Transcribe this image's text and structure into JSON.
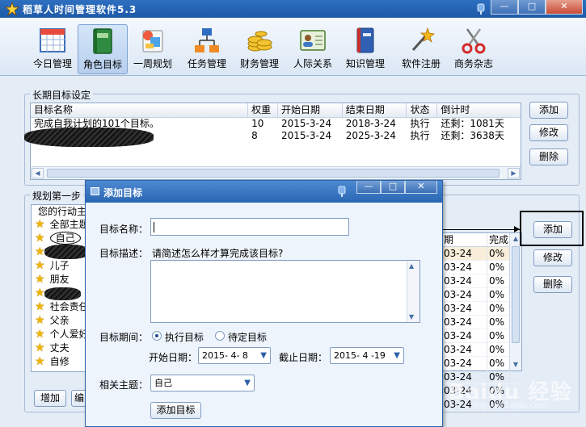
{
  "window": {
    "title": "稻草人时间管理软件5.3",
    "buttons": {
      "minimize": "—",
      "maximize": "□",
      "close": "✕"
    }
  },
  "toolbar": {
    "items": [
      {
        "label": "今日管理",
        "icon": "calendar-icon"
      },
      {
        "label": "角色目标",
        "icon": "book-icon",
        "active": true
      },
      {
        "label": "一周规划",
        "icon": "weekly-plan-icon"
      },
      {
        "label": "任务管理",
        "icon": "org-chart-icon"
      },
      {
        "label": "财务管理",
        "icon": "coins-icon"
      },
      {
        "label": "人际关系",
        "icon": "contact-card-icon"
      },
      {
        "label": "知识管理",
        "icon": "notebook-icon"
      },
      {
        "label": "软件注册",
        "icon": "magic-wand-icon"
      },
      {
        "label": "商务杂志",
        "icon": "scissors-icon"
      }
    ]
  },
  "long_term": {
    "title": "长期目标设定",
    "columns": [
      "目标名称",
      "权重",
      "开始日期",
      "结束日期",
      "状态",
      "倒计时"
    ],
    "rows": [
      {
        "name": "完成自我计划的101个目标。",
        "weight": "10",
        "start": "2015-3-24",
        "end": "2018-3-24",
        "status": "执行",
        "countdown": "还剩：1081天"
      },
      {
        "name": "",
        "weight": "8",
        "start": "2015-3-24",
        "end": "2025-3-24",
        "status": "执行",
        "countdown": "还剩：3638天"
      }
    ],
    "buttons": {
      "add": "添加",
      "edit": "修改",
      "delete": "删除"
    }
  },
  "plan": {
    "title": "规划第一步",
    "tree_header": "您的行动主",
    "nodes": [
      "全部主题",
      "自己",
      "",
      "儿子",
      "朋友",
      "",
      "社会责任",
      "父亲",
      "个人爱好",
      "丈夫",
      "自修"
    ],
    "bottom_buttons": {
      "add": "增加",
      "more": "编"
    },
    "buttons": {
      "add": "添加",
      "edit": "修改",
      "delete": "删除"
    },
    "right_table": {
      "columns": [
        "期",
        "完成"
      ],
      "rows": [
        [
          "03-24",
          "0%"
        ],
        [
          "03-24",
          "0%"
        ],
        [
          "03-24",
          "0%"
        ],
        [
          "03-24",
          "0%"
        ],
        [
          "03-24",
          "0%"
        ],
        [
          "03-24",
          "0%"
        ],
        [
          "03-24",
          "0%"
        ],
        [
          "03-24",
          "0%"
        ],
        [
          "03-24",
          "0%"
        ],
        [
          "03-24",
          "0%"
        ],
        [
          "03-24",
          "0%"
        ],
        [
          "03-24",
          "0%"
        ]
      ]
    }
  },
  "dialog": {
    "title": "添加目标",
    "name_label": "目标名称：",
    "name_value": "",
    "desc_label": "目标描述：",
    "desc_hint": "请简述怎么样才算完成该目标?",
    "period_label": "目标期间：",
    "radio_exec": "执行目标",
    "radio_pending": "待定目标",
    "start_label": "开始日期：",
    "start_value": "2015- 4- 8",
    "end_label": "截止日期：",
    "end_value": "2015- 4 -19",
    "topic_label": "相关主题：",
    "topic_value": "自己",
    "submit": "添加目标"
  },
  "watermark": {
    "main": "Baidu 经验",
    "sub": "jingyan.baidu.com"
  }
}
